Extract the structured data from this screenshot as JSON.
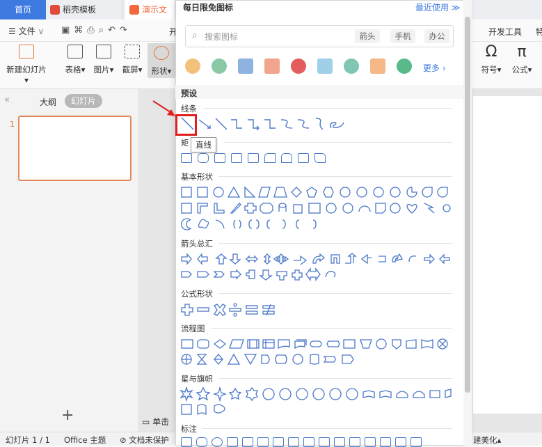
{
  "tabs": [
    {
      "label": "首页",
      "color": "#3d7ae0"
    },
    {
      "label": "稻壳模板",
      "color": "#e04a3a"
    },
    {
      "label": "演示文稿",
      "color": "#f26a3c"
    }
  ],
  "menu": {
    "file": "文件",
    "extra_label": "开",
    "dev_tools": "开发工具",
    "cut_text": "特"
  },
  "ribbon": [
    {
      "label": "新建幻灯片",
      "arrow": "▾"
    },
    {
      "label": "表格",
      "arrow": "▾"
    },
    {
      "label": "图片",
      "arrow": "▾"
    },
    {
      "label": "截屏",
      "arrow": "▾"
    },
    {
      "label": "形状",
      "arrow": "▾"
    },
    {
      "label": "符号",
      "arrow": "▾"
    },
    {
      "label": "公式",
      "arrow": "▾"
    }
  ],
  "leftpane": {
    "outline_tab": "大纲",
    "slides_tab": "幻灯片",
    "slide_num": "1",
    "add": "+"
  },
  "notes": {
    "prompt": "单击"
  },
  "status": {
    "slide_count": "幻灯片 1 / 1",
    "theme": "Office 主题",
    "protect": "文档未保护",
    "beautify": "建美化",
    "beautify_arrow": "▴"
  },
  "panel": {
    "header_title": "每日限免图标",
    "recent": "最近使用",
    "recent_arrow": "≫",
    "search_placeholder": "搜索图标",
    "search_tags": [
      "箭头",
      "手机",
      "办公"
    ],
    "more": "更多",
    "more_arrow": "›",
    "icons": [
      "head-icon",
      "doctor-icon",
      "xray-icon",
      "monitor-icon",
      "heart-icon",
      "report-icon",
      "medicine-icon",
      "thermometer-icon",
      "shield-icon"
    ],
    "preset": "预设",
    "sections": {
      "lines": "线条",
      "rect": "矩",
      "basic": "基本形状",
      "arrows": "箭头总汇",
      "equation": "公式形状",
      "flowchart": "流程图",
      "stars": "星与旗帜",
      "callouts": "标注"
    },
    "tooltip": "直线"
  },
  "colors": {
    "accent": "#3d7ae0",
    "shape_stroke": "#4a77c9",
    "highlight": "#e02020"
  }
}
